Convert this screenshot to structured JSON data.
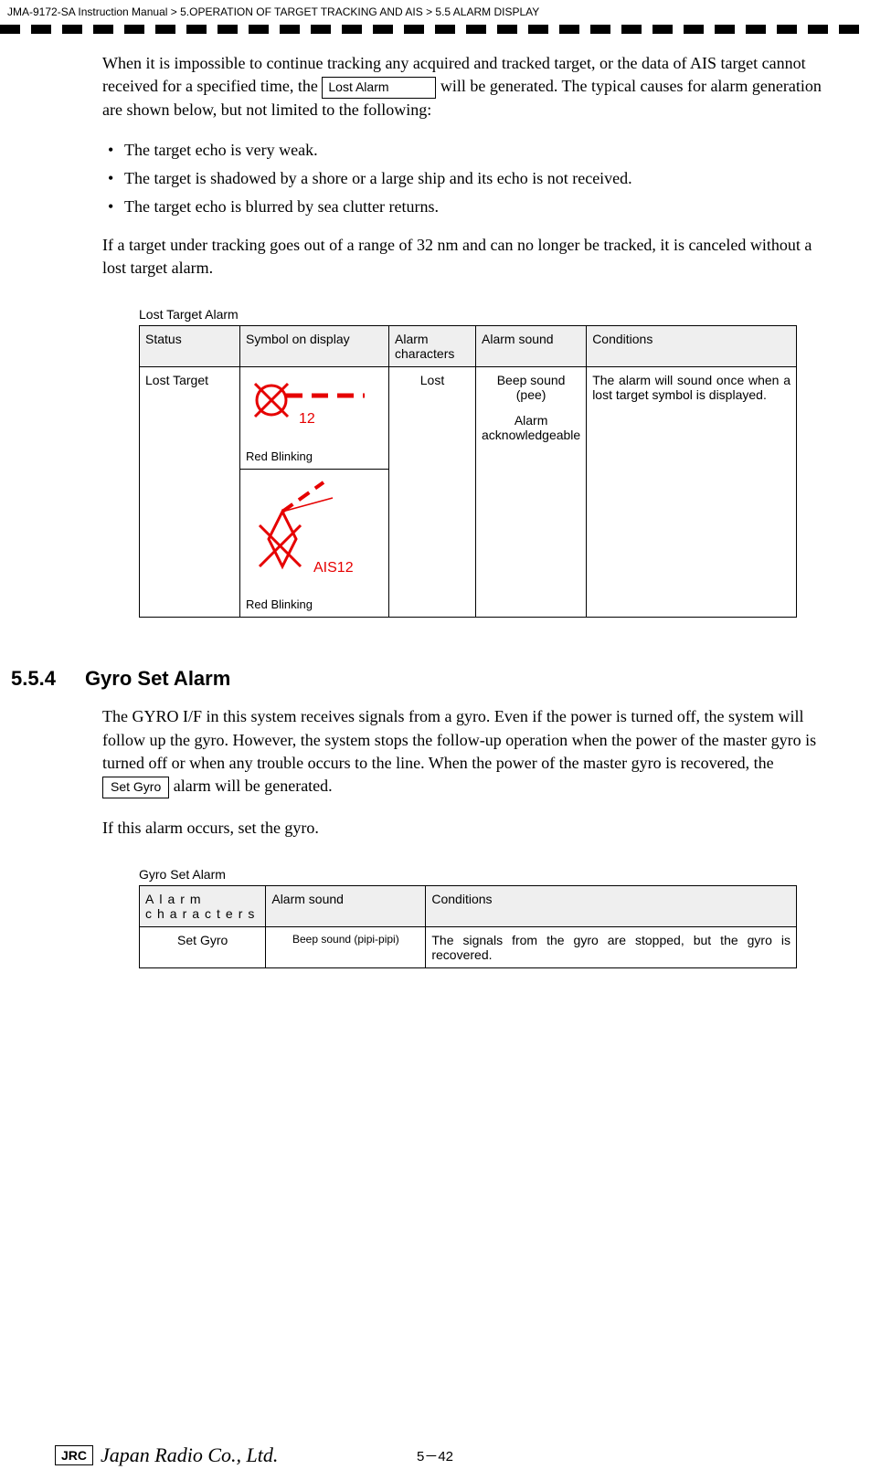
{
  "header": {
    "manual": "JMA-9172-SA Instruction Manual",
    "chapter": "5.OPERATION OF TARGET TRACKING AND AIS",
    "section": "5.5  ALARM DISPLAY"
  },
  "intro": {
    "p1a": "When it is impossible to continue tracking any acquired and tracked target, or the data of AIS target cannot received for a specified time, the ",
    "lost_alarm_label": "Lost Alarm",
    "p1b": " will be generated. The typical causes for alarm generation are shown below, but not limited to the following:"
  },
  "bullets": [
    "The target echo is very weak.",
    "The target is shadowed by a shore or a large ship and its echo is not received.",
    "The target echo is blurred by sea clutter returns."
  ],
  "para2": "If a target under tracking goes out of a range of 32 nm and can no longer be tracked, it is canceled without a lost target alarm.",
  "lost_table": {
    "caption": "Lost Target Alarm",
    "headers": {
      "status": "Status",
      "symbol": "Symbol on display",
      "alarm_chars": "Alarm characters",
      "alarm_sound": "Alarm sound",
      "conditions": "Conditions"
    },
    "row": {
      "status": "Lost Target",
      "symbol_num1": "12",
      "red_blink1": "Red Blinking",
      "symbol_num2": "AIS12",
      "red_blink2": "Red Blinking",
      "alarm_chars": "Lost",
      "alarm_sound_a": "Beep sound (pee)",
      "alarm_sound_b": "Alarm acknowledgeable",
      "conditions": "The alarm will sound once when a lost target symbol is displayed."
    }
  },
  "section554": {
    "num": "5.5.4",
    "title": "Gyro Set Alarm"
  },
  "gyro_para1a": "The GYRO I/F in this system receives signals from a gyro. Even if the power is turned off, the system will follow up the gyro. However, the system stops the follow-up operation when the power of the master gyro is turned off or when any trouble occurs to the line. When the power of the master gyro is recovered, the ",
  "set_gyro_label": "Set Gyro",
  "gyro_para1b": " alarm will be generated.",
  "gyro_para2": "If this alarm occurs, set the gyro.",
  "gyro_table": {
    "caption": "Gyro Set Alarm",
    "headers": {
      "alarm_chars": "Alarm characters",
      "alarm_sound": "Alarm sound",
      "conditions": "Conditions"
    },
    "row": {
      "alarm_chars": "Set Gyro",
      "alarm_sound": "Beep sound (pipi-pipi)",
      "conditions": "The signals from the gyro are stopped, but the gyro is recovered."
    }
  },
  "footer": {
    "logo": "JRC",
    "company": "Japan Radio Co., Ltd.",
    "page": "5－42"
  }
}
